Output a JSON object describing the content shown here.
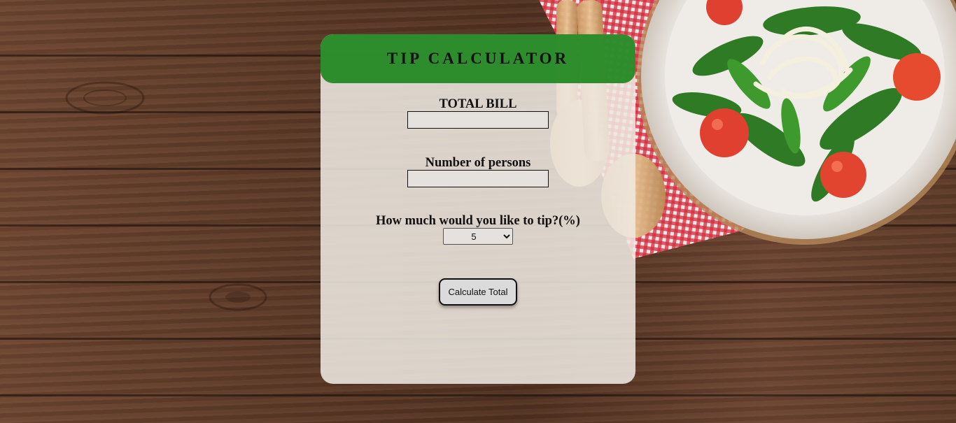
{
  "header": {
    "title": "TIP CALCULATOR"
  },
  "form": {
    "bill_label": "TOTAL BILL",
    "bill_value": "",
    "persons_label": "Number of persons",
    "persons_value": "",
    "tip_label": "How much would you like to tip?(%)",
    "tip_selected": "5",
    "button_label": "Calculate Total"
  },
  "colors": {
    "header_green": "#148214",
    "card_bg": "#eee8e0",
    "wood": "#5a3826",
    "tablecloth_red": "#d42a3a"
  },
  "decor": {
    "background_image": "wooden-table-with-salad-plate-icon"
  }
}
